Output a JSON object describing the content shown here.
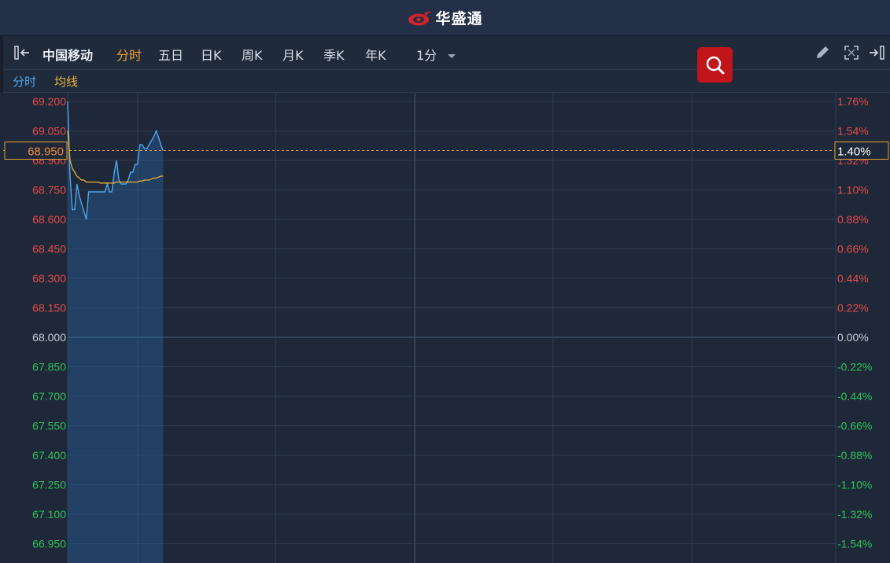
{
  "app": {
    "brand": "华盛通"
  },
  "toolbar": {
    "stock_name": "中国移动",
    "tabs": [
      {
        "label": "分时",
        "active": true
      },
      {
        "label": "五日",
        "active": false
      },
      {
        "label": "日K",
        "active": false
      },
      {
        "label": "周K",
        "active": false
      },
      {
        "label": "月K",
        "active": false
      },
      {
        "label": "季K",
        "active": false
      },
      {
        "label": "年K",
        "active": false
      }
    ],
    "interval": "1分"
  },
  "legend": {
    "line1": "分时",
    "line2": "均线"
  },
  "colors": {
    "up": "#e84a4a",
    "down": "#2ec35a",
    "price_line": "#4ea6f0",
    "avg_line": "#e6b33a",
    "grid": "#2f3d52",
    "brand_red": "#c0151a"
  },
  "chart_data": {
    "type": "line",
    "base_price": 68.0,
    "current_price": "68.950",
    "current_change": "1.40%",
    "left_ticks": [
      "69.200",
      "69.050",
      "68.900",
      "68.750",
      "68.600",
      "68.450",
      "68.300",
      "68.150",
      "68.000",
      "67.850",
      "67.700",
      "67.550",
      "67.400",
      "67.250",
      "67.100",
      "66.950"
    ],
    "right_ticks": [
      "1.76%",
      "1.54%",
      "1.32%",
      "1.10%",
      "0.88%",
      "0.66%",
      "0.44%",
      "0.22%",
      "0.00%",
      "-0.22%",
      "-0.44%",
      "-0.66%",
      "-0.88%",
      "-1.10%",
      "-1.32%",
      "-1.54%"
    ],
    "ylim": [
      66.85,
      69.25
    ],
    "total_minutes": 330,
    "series": [
      {
        "name": "分时",
        "x": [
          0,
          1,
          2,
          3,
          4,
          5,
          6,
          7,
          8,
          9,
          10,
          11,
          12,
          13,
          14,
          15,
          16,
          17,
          18,
          19,
          20,
          21,
          22,
          23,
          24,
          25,
          26,
          27,
          28,
          29,
          30,
          31,
          32,
          33,
          34,
          35,
          36,
          37,
          38,
          39,
          40,
          41
        ],
        "values": [
          69.2,
          68.82,
          68.65,
          68.65,
          68.78,
          68.72,
          68.68,
          68.64,
          68.6,
          68.74,
          68.74,
          68.74,
          68.74,
          68.74,
          68.74,
          68.74,
          68.74,
          68.78,
          68.74,
          68.74,
          68.84,
          68.9,
          68.8,
          68.78,
          68.78,
          68.78,
          68.8,
          68.84,
          68.84,
          68.88,
          68.88,
          68.98,
          68.98,
          68.96,
          68.96,
          68.98,
          69.0,
          69.02,
          69.05,
          69.02,
          68.98,
          68.95
        ]
      },
      {
        "name": "均线",
        "x": [
          0,
          1,
          2,
          3,
          4,
          5,
          6,
          7,
          8,
          9,
          10,
          11,
          12,
          13,
          14,
          15,
          16,
          17,
          18,
          19,
          20,
          21,
          22,
          23,
          24,
          25,
          26,
          27,
          28,
          29,
          30,
          31,
          32,
          33,
          34,
          35,
          36,
          37,
          38,
          39,
          40,
          41
        ],
        "values": [
          69.05,
          68.9,
          68.86,
          68.84,
          68.82,
          68.81,
          68.8,
          68.8,
          68.79,
          68.79,
          68.79,
          68.79,
          68.79,
          68.79,
          68.785,
          68.785,
          68.785,
          68.785,
          68.785,
          68.785,
          68.785,
          68.79,
          68.79,
          68.79,
          68.79,
          68.79,
          68.79,
          68.79,
          68.79,
          68.79,
          68.79,
          68.795,
          68.795,
          68.8,
          68.8,
          68.8,
          68.805,
          68.81,
          68.81,
          68.815,
          68.82,
          68.82
        ]
      }
    ]
  }
}
